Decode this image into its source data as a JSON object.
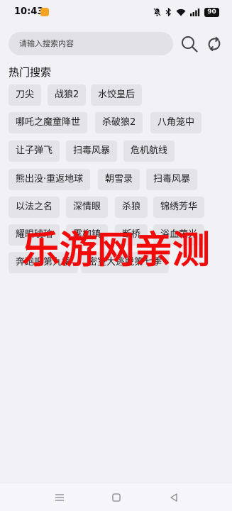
{
  "status_bar": {
    "time": "10:43",
    "battery": "90"
  },
  "search": {
    "placeholder": "请输入搜索内容"
  },
  "hot_search": {
    "title": "热门搜索",
    "items": [
      "刀尖",
      "战狼2",
      "水饺皇后",
      "哪吒之魔童降世",
      "杀破狼2",
      "八角笼中",
      "让子弹飞",
      "扫毒风暴",
      "危机航线",
      "熊出没·重返地球",
      "朝雪录",
      "扫毒风暴",
      "以法之名",
      "深情眼",
      "杀狼",
      "锦绣芳华",
      "耀眼琥珀",
      "雾柳镇",
      "断桥",
      "浴血荣光",
      "奔跑吧第九季",
      "密室大逃脱第七季"
    ]
  },
  "watermark": "乐游网亲测"
}
